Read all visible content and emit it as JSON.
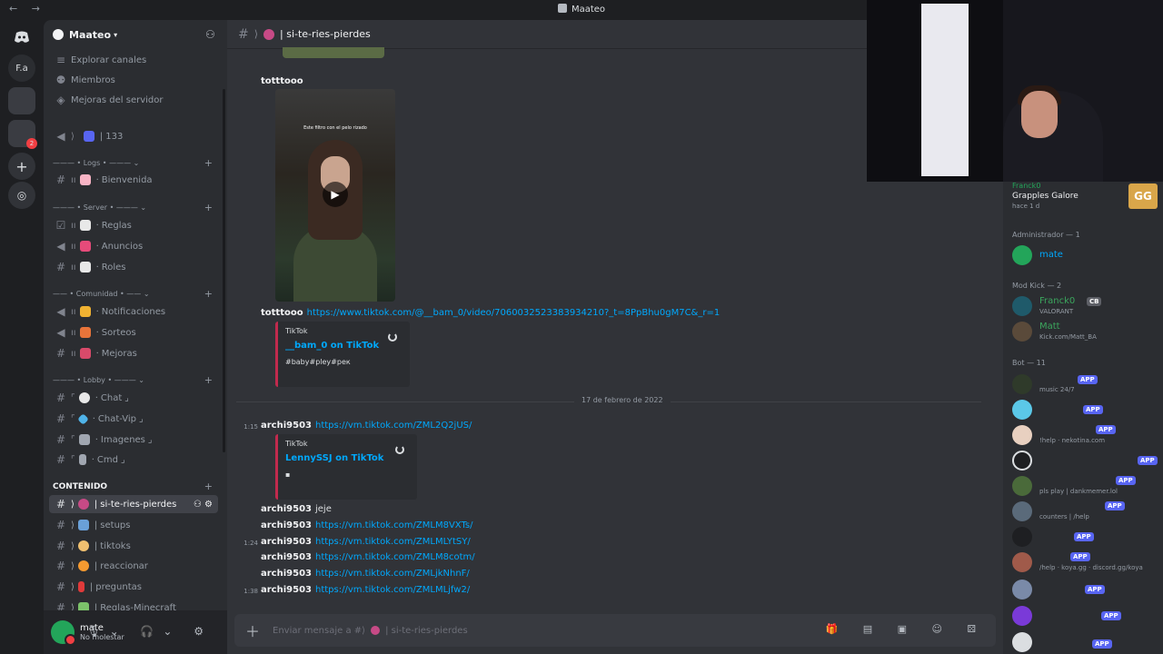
{
  "window": {
    "nav": "← →",
    "title": "Maateo"
  },
  "guilds": [
    "F.a"
  ],
  "server": {
    "name": "Maateo"
  },
  "top_links": [
    "Explorar canales",
    "Miembros",
    "Mejoras del servidor"
  ],
  "voice": {
    "label": "133"
  },
  "categories": {
    "logs": "——— • Logs • ———",
    "server": "——— • Server • ———",
    "comunidad": "—— • Comunidad • ——",
    "lobby": "——— • Lobby • ———",
    "contenido": "CONTENIDO"
  },
  "channels": {
    "bienvenida": "Bienvenida",
    "reglas": "Reglas",
    "anuncios": "Anuncios",
    "roles": "Roles",
    "notificaciones": "Notificaciones",
    "sorteos": "Sorteos",
    "mejoras": "Mejoras",
    "chat": "Chat",
    "chat_vip": "Chat-Vip",
    "imagenes": "Imagenes",
    "cmd": "Cmd",
    "si_te_ries": "si-te-ries-pierdes",
    "setups": "setups",
    "tiktoks": "tiktoks",
    "reaccionar": "reaccionar",
    "preguntas": "preguntas",
    "reglas_mc": "Reglas-Minecraft"
  },
  "user": {
    "name": "mate",
    "status": "No molestar"
  },
  "header": {
    "channel": "| si-te-ries-pierdes"
  },
  "messages": {
    "m1_user": "totttooo",
    "m2_user": "totttooo",
    "m2_link": "https://www.tiktok.com/@__bam_0/video/7060032523383934210?_t=8PpBhu0gM7C&_r=1",
    "embed1": {
      "provider": "TikTok",
      "title": "__bam_0 on TikTok",
      "desc": "#baby#pley#рек"
    },
    "video_caption": "Este filtro con el pelo rizado",
    "date": "17 de febrero de 2022",
    "m3_ts": "1:15",
    "m3_user": "archi9503",
    "m3_link": "https://vm.tiktok.com/ZML2Q2jUS/",
    "embed2": {
      "provider": "TikTok",
      "title": "LennySSJ on TikTok"
    },
    "m4_user": "archi9503",
    "m4_text": "jeje",
    "m5_user": "archi9503",
    "m5_link": "https://vm.tiktok.com/ZMLM8VXTs/",
    "m6_ts": "1:24",
    "m6_user": "archi9503",
    "m6_link": "https://vm.tiktok.com/ZMLMLYtSY/",
    "m7_user": "archi9503",
    "m7_link": "https://vm.tiktok.com/ZMLM8cotm/",
    "m8_user": "archi9503",
    "m8_link": "https://vm.tiktok.com/ZMLjkNhnF/",
    "m9_ts": "1:38",
    "m9_user": "archi9503",
    "m9_link": "https://vm.tiktok.com/ZMLMLjfw2/"
  },
  "composer": {
    "placeholder": "Enviar mensaje a #⟩",
    "channel": "| si-te-ries-pierdes"
  },
  "members": {
    "activity": {
      "user": "Franck0",
      "game": "Grapples Galore",
      "time": "hace 1 d",
      "badge": "GG"
    },
    "admin_group": "Administrador — 1",
    "admin": {
      "name": "mate"
    },
    "mod_group": "Mod Kick — 2",
    "mod1": {
      "name": "Franck0",
      "tag": "CB",
      "status": "VALORANT"
    },
    "mod2": {
      "name": "Matt",
      "status": "Kick.com/Matt_BA"
    },
    "bot_group": "Bot — 11",
    "bots": [
      {
        "status": "music 24/7"
      },
      {
        "status": ""
      },
      {
        "status": "!help · nekotina.com"
      },
      {
        "status": ""
      },
      {
        "status": "pls play | dankmemer.lol"
      },
      {
        "status": "counters | /help"
      },
      {
        "status": ""
      },
      {
        "status": "/help · koya.gg · discord.gg/koya"
      },
      {
        "status": ""
      },
      {
        "status": ""
      },
      {
        "status": ""
      }
    ],
    "app_label": "APP"
  },
  "colors": {
    "accent": "#5865f2",
    "link": "#00a8fc",
    "online": "#23a55a",
    "dnd": "#f23f43",
    "embed_border": "#c12a4d"
  }
}
